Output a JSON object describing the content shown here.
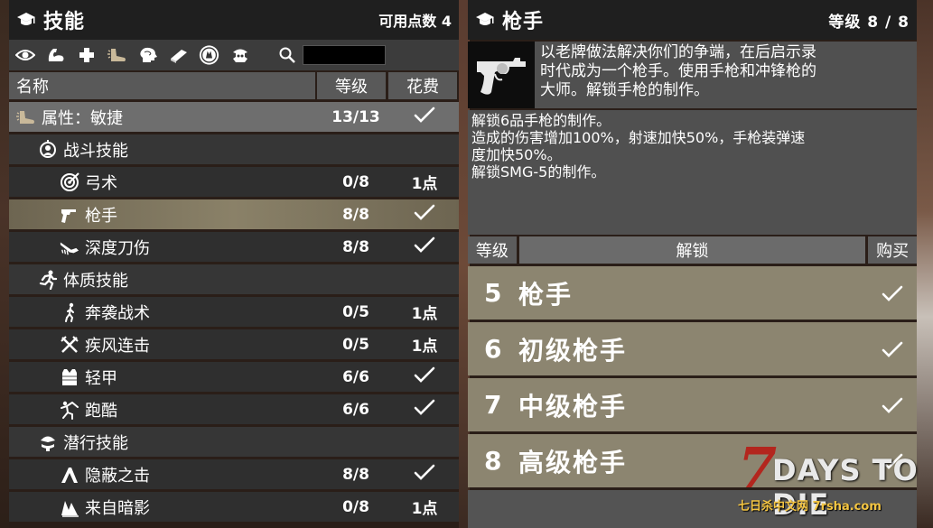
{
  "left_panel": {
    "title": "技能",
    "points_label": "可用点数 4",
    "search": {
      "value": "",
      "placeholder": ""
    },
    "columns": {
      "name": "名称",
      "level": "等级",
      "cost": "花费"
    },
    "rows": [
      {
        "name": "属性：敏捷",
        "level": "13/13",
        "cost": "✓",
        "kind": "attr",
        "icon": "boot-icon"
      },
      {
        "name": "战斗技能",
        "level": "",
        "cost": "",
        "kind": "cat",
        "icon": "crosshair-icon"
      },
      {
        "name": "弓术",
        "level": "0/8",
        "cost": "1点",
        "kind": "skill",
        "icon": "target-icon"
      },
      {
        "name": "枪手",
        "level": "8/8",
        "cost": "✓",
        "kind": "skill-selected",
        "icon": "pistol-icon"
      },
      {
        "name": "深度刀伤",
        "level": "8/8",
        "cost": "✓",
        "kind": "skill",
        "icon": "knife-icon"
      },
      {
        "name": "体质技能",
        "level": "",
        "cost": "",
        "kind": "cat",
        "icon": "running-icon"
      },
      {
        "name": "奔袭战术",
        "level": "0/5",
        "cost": "1点",
        "kind": "skill",
        "icon": "runner-icon"
      },
      {
        "name": "疾风连击",
        "level": "0/5",
        "cost": "1点",
        "kind": "skill",
        "icon": "crossed-blades-icon"
      },
      {
        "name": "轻甲",
        "level": "6/6",
        "cost": "✓",
        "kind": "skill",
        "icon": "vest-icon"
      },
      {
        "name": "跑酷",
        "level": "6/6",
        "cost": "✓",
        "kind": "skill",
        "icon": "parkour-icon"
      },
      {
        "name": "潜行技能",
        "level": "",
        "cost": "",
        "kind": "cat",
        "icon": "stealth-icon"
      },
      {
        "name": "隐蔽之击",
        "level": "8/8",
        "cost": "✓",
        "kind": "skill",
        "icon": "hidden-strike-icon"
      },
      {
        "name": "来自暗影",
        "level": "0/8",
        "cost": "1点",
        "kind": "skill",
        "icon": "shadow-icon"
      }
    ]
  },
  "right_panel": {
    "title": "枪手",
    "level_label": "等级 8 / 8",
    "description_lines": [
      "以老牌做法解决你们的争端，在后启示录",
      "时代成为一个枪手。使用手枪和冲锋枪的",
      "大师。解锁手枪的制作。"
    ],
    "effect_lines": [
      "解锁6品手枪的制作。",
      "造成的伤害增加100%，射速加快50%，手枪装弹速",
      "度加快50%。",
      "解锁SMG-5的制作。"
    ],
    "columns": {
      "level": "等级",
      "unlock": "解锁",
      "buy": "购买"
    },
    "unlocks": [
      {
        "level": "5",
        "name": "枪手",
        "status": "✓"
      },
      {
        "level": "6",
        "name": "初级枪手",
        "status": "✓"
      },
      {
        "level": "7",
        "name": "中级枪手",
        "status": "✓"
      },
      {
        "level": "8",
        "name": "高级枪手",
        "status": "✓"
      }
    ]
  },
  "watermark": {
    "logo_number": "7",
    "logo_text": "DAYS TO DIE",
    "site_text": "七日杀中文网 7rsha.com"
  },
  "colors": {
    "title_bg": "#1f1f1f",
    "row_bg": "#2f2f2f",
    "selected_row": "#8a8168",
    "unlock_row": "#8c8570",
    "logo_red": "#b3261e"
  }
}
